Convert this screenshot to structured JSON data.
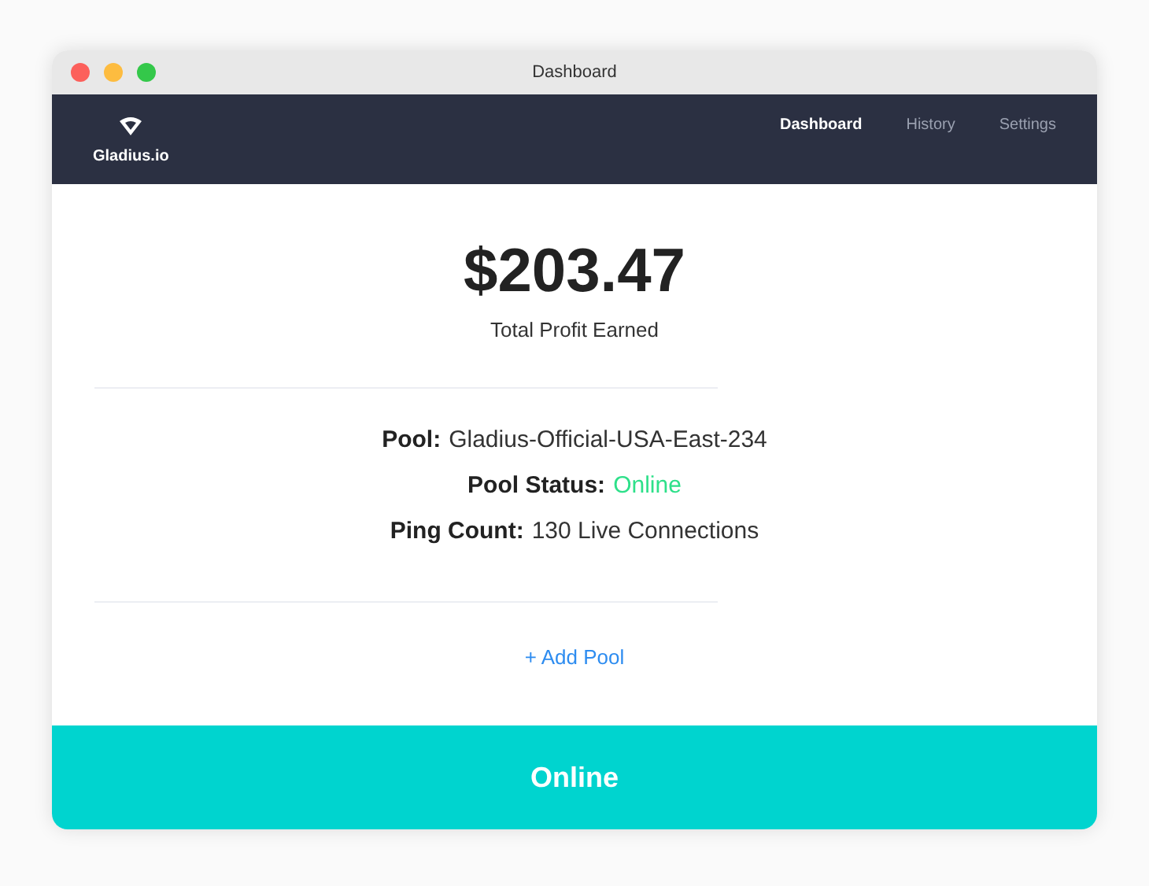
{
  "window": {
    "title": "Dashboard"
  },
  "brand": {
    "name": "Gladius.io"
  },
  "tabs": [
    {
      "label": "Dashboard",
      "selected": true
    },
    {
      "label": "History",
      "selected": false
    },
    {
      "label": "Settings",
      "selected": false
    }
  ],
  "profit": {
    "amount": "$203.47",
    "caption": "Total Profit Earned"
  },
  "details": [
    {
      "label": "Pool:",
      "value": "Gladius-Official-USA-East-234",
      "kind": "text"
    },
    {
      "label": "Pool Status:",
      "value": "Online",
      "kind": "status"
    },
    {
      "label": "Ping Count:",
      "value": "130 Live Connections",
      "kind": "text"
    }
  ],
  "add_pool": {
    "label": "+ Add Pool"
  },
  "status_bar": {
    "label": "Online"
  }
}
